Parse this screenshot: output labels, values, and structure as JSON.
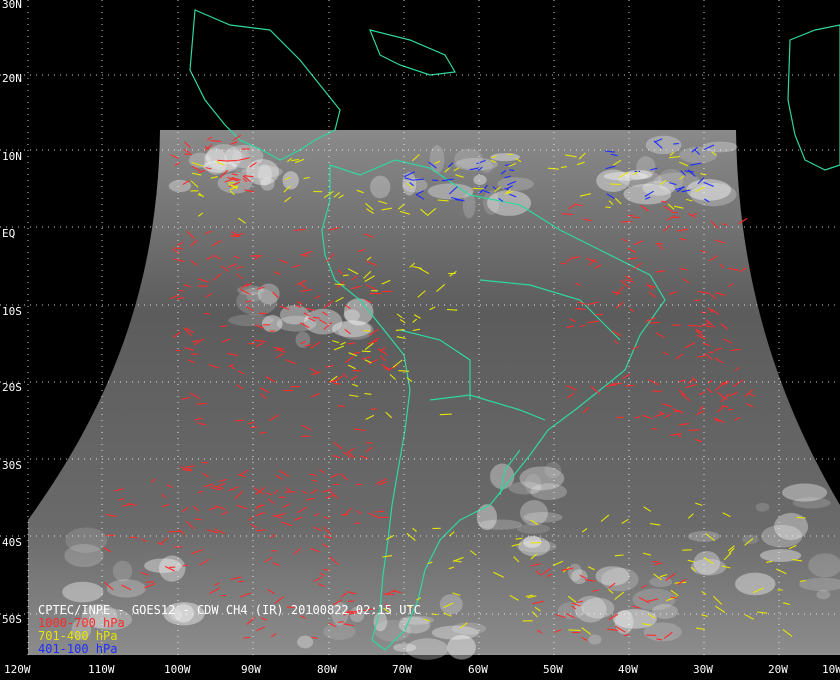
{
  "caption": {
    "title": "CPTEC/INPE - GOES12 - CDW CH4 (IR) 20100822 02:15 UTC",
    "legend": [
      {
        "label": "1000-700 hPa",
        "color": "#ff2a2a"
      },
      {
        "label": "701-400 hPa",
        "color": "#e6e600"
      },
      {
        "label": "401-100 hPa",
        "color": "#1e2cff"
      }
    ]
  },
  "latitude_labels": [
    "30N",
    "20N",
    "10N",
    "EQ",
    "10S",
    "20S",
    "30S",
    "40S",
    "50S"
  ],
  "longitude_labels": [
    "120W",
    "110W",
    "100W",
    "90W",
    "80W",
    "70W",
    "60W",
    "50W",
    "40W",
    "30W",
    "20W",
    "10W"
  ],
  "colors": {
    "background": "#000000",
    "coastline": "#2fd7a0",
    "grid": "#ffffff",
    "text": "#ffffff"
  }
}
